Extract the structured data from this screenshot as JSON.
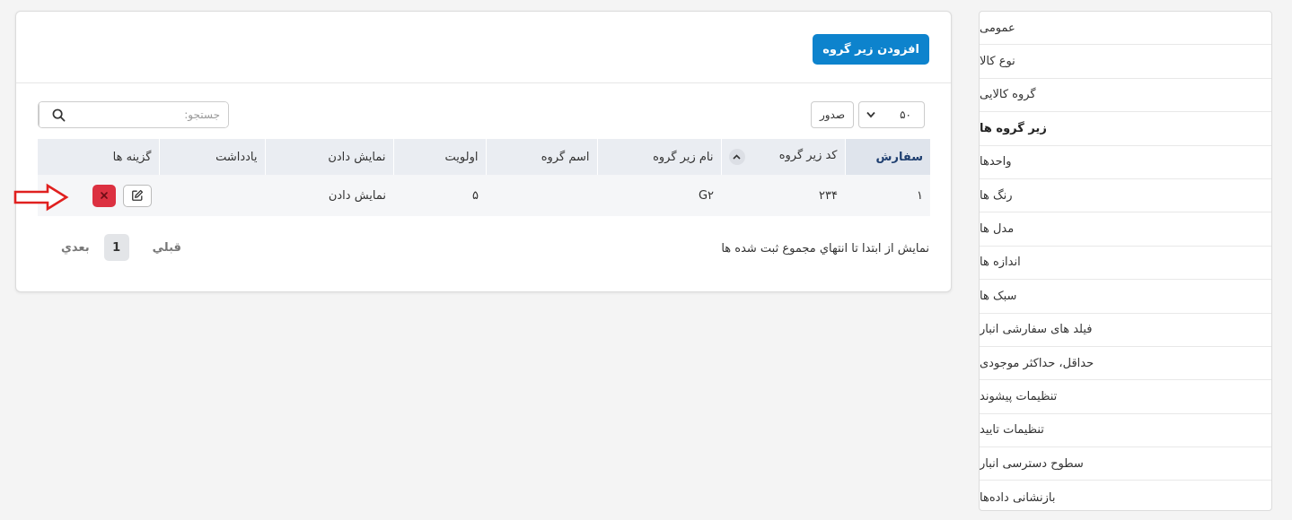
{
  "sidebar": {
    "items": [
      {
        "label": "عمومی",
        "active": false
      },
      {
        "label": "نوع کالا",
        "active": false
      },
      {
        "label": "گروه کالایی",
        "active": false
      },
      {
        "label": "زیر گروه ها",
        "active": true
      },
      {
        "label": "واحدها",
        "active": false
      },
      {
        "label": "رنگ ها",
        "active": false
      },
      {
        "label": "مدل ها",
        "active": false
      },
      {
        "label": "اندازه ها",
        "active": false
      },
      {
        "label": "سبک ها",
        "active": false
      },
      {
        "label": "فیلد های سفارشی انبار",
        "active": false
      },
      {
        "label": "حداقل، حداکثر موجودی",
        "active": false
      },
      {
        "label": "تنظیمات پیشوند",
        "active": false
      },
      {
        "label": "تنظیمات تایید",
        "active": false
      },
      {
        "label": "سطوح دسترسی انبار",
        "active": false
      },
      {
        "label": "بازنشانی داده‌ها",
        "active": false
      }
    ]
  },
  "header": {
    "add_button_label": "افزودن زیر گروه"
  },
  "controls": {
    "page_size_value": "۵۰",
    "export_label": "صدور",
    "search_placeholder": "جستجو:"
  },
  "table": {
    "columns": [
      "سفارش",
      "کد زیر گروه",
      "نام زیر گروه",
      "اسم گروه",
      "اولویت",
      "نمایش دادن",
      "یادداشت",
      "گزینه ها"
    ],
    "rows": [
      {
        "order": "۱",
        "code": "۲۳۴",
        "name": "G۲",
        "group": "",
        "priority": "۵",
        "display": "نمایش دادن",
        "note": ""
      }
    ]
  },
  "footer": {
    "info": "نمایش از ابتدا تا انتهاي مجموع ثبت شده ها",
    "prev_label": "قبلي",
    "current_page": "1",
    "next_label": "بعدي"
  },
  "colors": {
    "primary": "#0d83cd",
    "danger": "#dc3141",
    "annotation_arrow": "#e0201f"
  }
}
